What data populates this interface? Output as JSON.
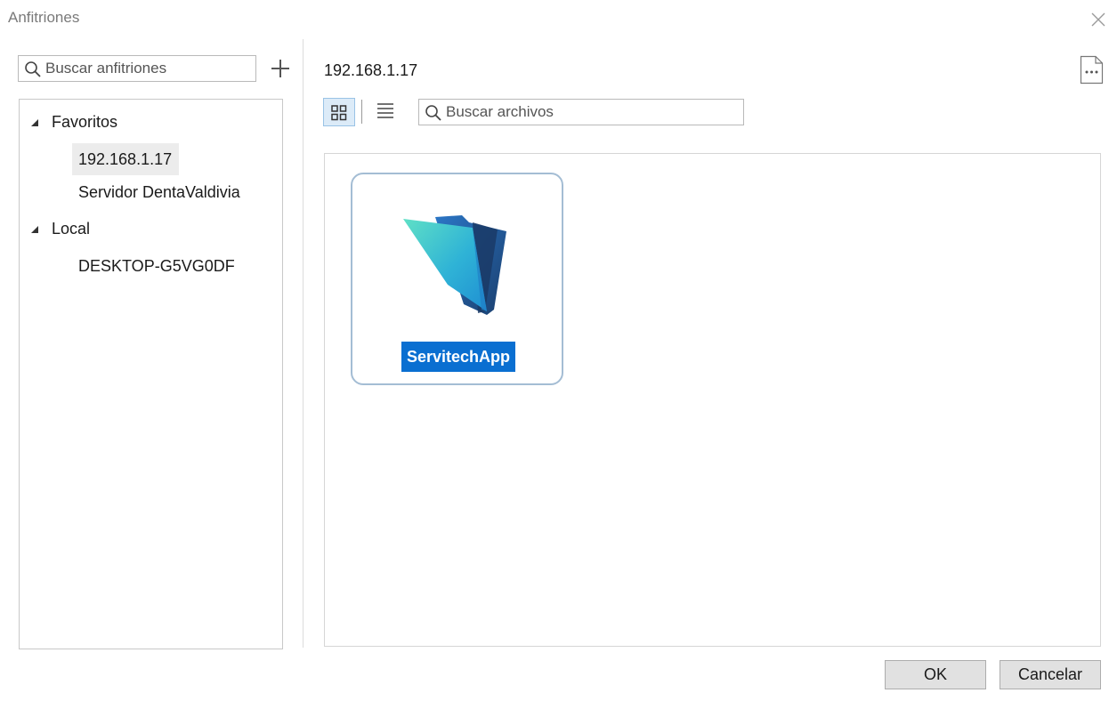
{
  "window": {
    "title": "Anfitriones"
  },
  "hosts": {
    "search_placeholder": "Buscar anfitriones",
    "groups": [
      {
        "label": "Favoritos",
        "items": [
          "192.168.1.17",
          "Servidor DentaValdivia"
        ]
      },
      {
        "label": "Local",
        "items": [
          "DESKTOP-G5VG0DF"
        ]
      }
    ],
    "selected": "192.168.1.17"
  },
  "files": {
    "current_host": "192.168.1.17",
    "search_placeholder": "Buscar archivos",
    "view_mode": "grid",
    "items": [
      {
        "name": "ServitechApp",
        "icon": "filemaker-folder-icon"
      }
    ]
  },
  "footer": {
    "ok_label": "OK",
    "cancel_label": "Cancelar"
  },
  "colors": {
    "accent": "#0a6fd1",
    "selection": "#ececec",
    "tile_border": "#a4bdd4"
  }
}
